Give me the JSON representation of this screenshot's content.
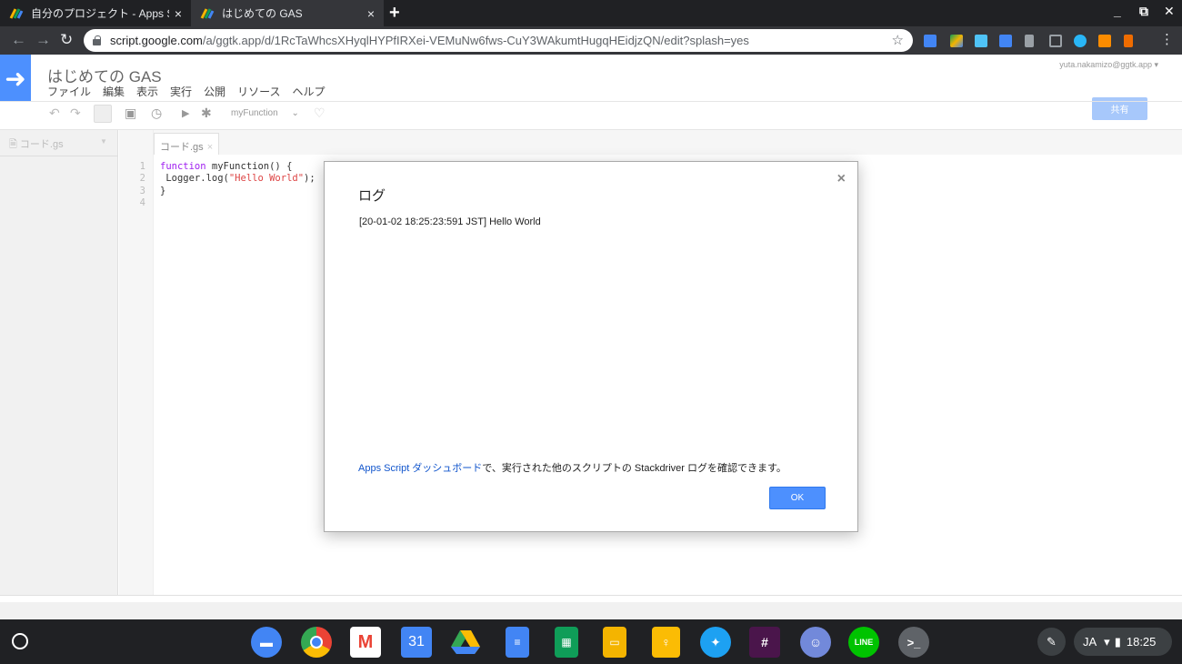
{
  "browser": {
    "tabs": [
      {
        "title": "自分のプロジェクト - Apps Sc",
        "active": false
      },
      {
        "title": "はじめての GAS",
        "active": true
      }
    ],
    "new_tab": "+",
    "close_glyph": "×",
    "url_host": "script.google.com",
    "url_path": "/a/ggtk.app/d/1RcTaWhcsXHyqlHYPfIRXei-VEMuNw6fws-CuY3WAkumtHugqHEidjzQN/edit?splash=yes",
    "window_controls": [
      "_",
      "⧉",
      "✕"
    ]
  },
  "gas": {
    "project_title": "はじめての GAS",
    "menu": [
      "ファイル",
      "編集",
      "表示",
      "実行",
      "公開",
      "リソース",
      "ヘルプ"
    ],
    "account": "yuta.nakamizo@ggtk.app",
    "share_label": "共有",
    "function_select": "myFunction",
    "file_name": "コード.gs",
    "editor_tab": "コード.gs",
    "code_lines": [
      {
        "n": "1",
        "text": "function myFunction() {"
      },
      {
        "n": "2",
        "text": "  Logger.log(\"Hello World\");"
      },
      {
        "n": "3",
        "text": "}"
      },
      {
        "n": "4",
        "text": ""
      }
    ]
  },
  "dialog": {
    "title": "ログ",
    "log_line": "[20-01-02 18:25:23:591 JST] Hello World",
    "note_link": "Apps Script ダッシュボード",
    "note_rest": "で、実行された他のスクリプトの Stackdriver ログを確認できます。",
    "ok_label": "OK",
    "close_glyph": "×"
  },
  "shelf": {
    "apps": [
      "files",
      "chrome",
      "gmail",
      "calendar",
      "drive",
      "docs",
      "sheets",
      "slides",
      "keep",
      "twitter",
      "slack",
      "discord",
      "line",
      "terminal"
    ],
    "calendar_day": "31",
    "terminal_glyph": ">_",
    "ime": "JA",
    "time": "18:25"
  },
  "colors": {
    "accent": "#4d90fe",
    "share_disabled": "#a7c8fb",
    "link": "#1155cc"
  }
}
